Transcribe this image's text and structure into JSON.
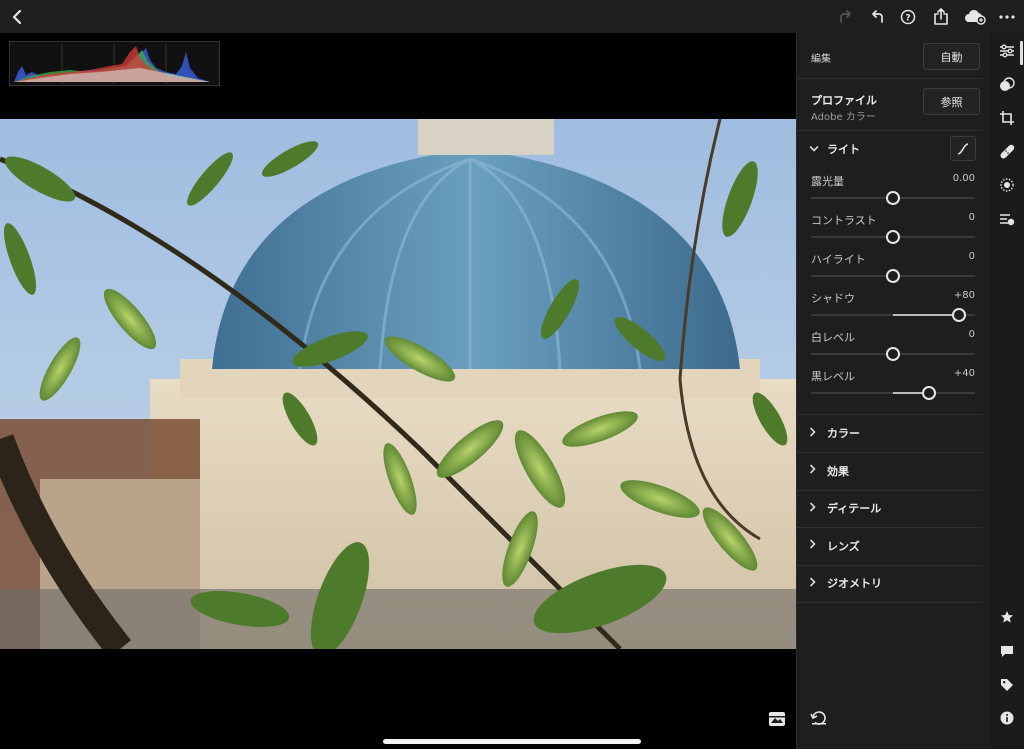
{
  "topbar": {
    "icons": [
      "back-icon",
      "redo-icon",
      "undo-icon",
      "help-icon",
      "share-icon",
      "cloud-sync-icon",
      "more-icon"
    ]
  },
  "panel": {
    "edit_label": "編集",
    "auto_button": "自動",
    "profile_title": "プロファイル",
    "profile_value": "Adobe カラー",
    "browse_button": "参照",
    "light": {
      "title": "ライト",
      "sliders": [
        {
          "label": "露光量",
          "value": "0.00",
          "level": 0.5
        },
        {
          "label": "コントラスト",
          "value": "0",
          "level": 0.5
        },
        {
          "label": "ハイライト",
          "value": "0",
          "level": 0.5
        },
        {
          "label": "シャドウ",
          "value": "+80",
          "level": 0.9
        },
        {
          "label": "白レベル",
          "value": "0",
          "level": 0.5
        },
        {
          "label": "黒レベル",
          "value": "+40",
          "level": 0.72
        }
      ]
    },
    "sections": [
      "カラー",
      "効果",
      "ディテール",
      "レンズ",
      "ジオメトリ"
    ]
  },
  "rail": {
    "icons": [
      "edit-sliders-icon",
      "masking-icon",
      "crop-icon",
      "healing-icon",
      "selective-icon",
      "presets-icon",
      "rating-star-icon",
      "comment-icon",
      "tag-icon",
      "info-icon"
    ]
  },
  "colors": {
    "panel_bg": "#1e1e1e",
    "sky": "#a9c3de",
    "dome": "#4f86a8"
  }
}
